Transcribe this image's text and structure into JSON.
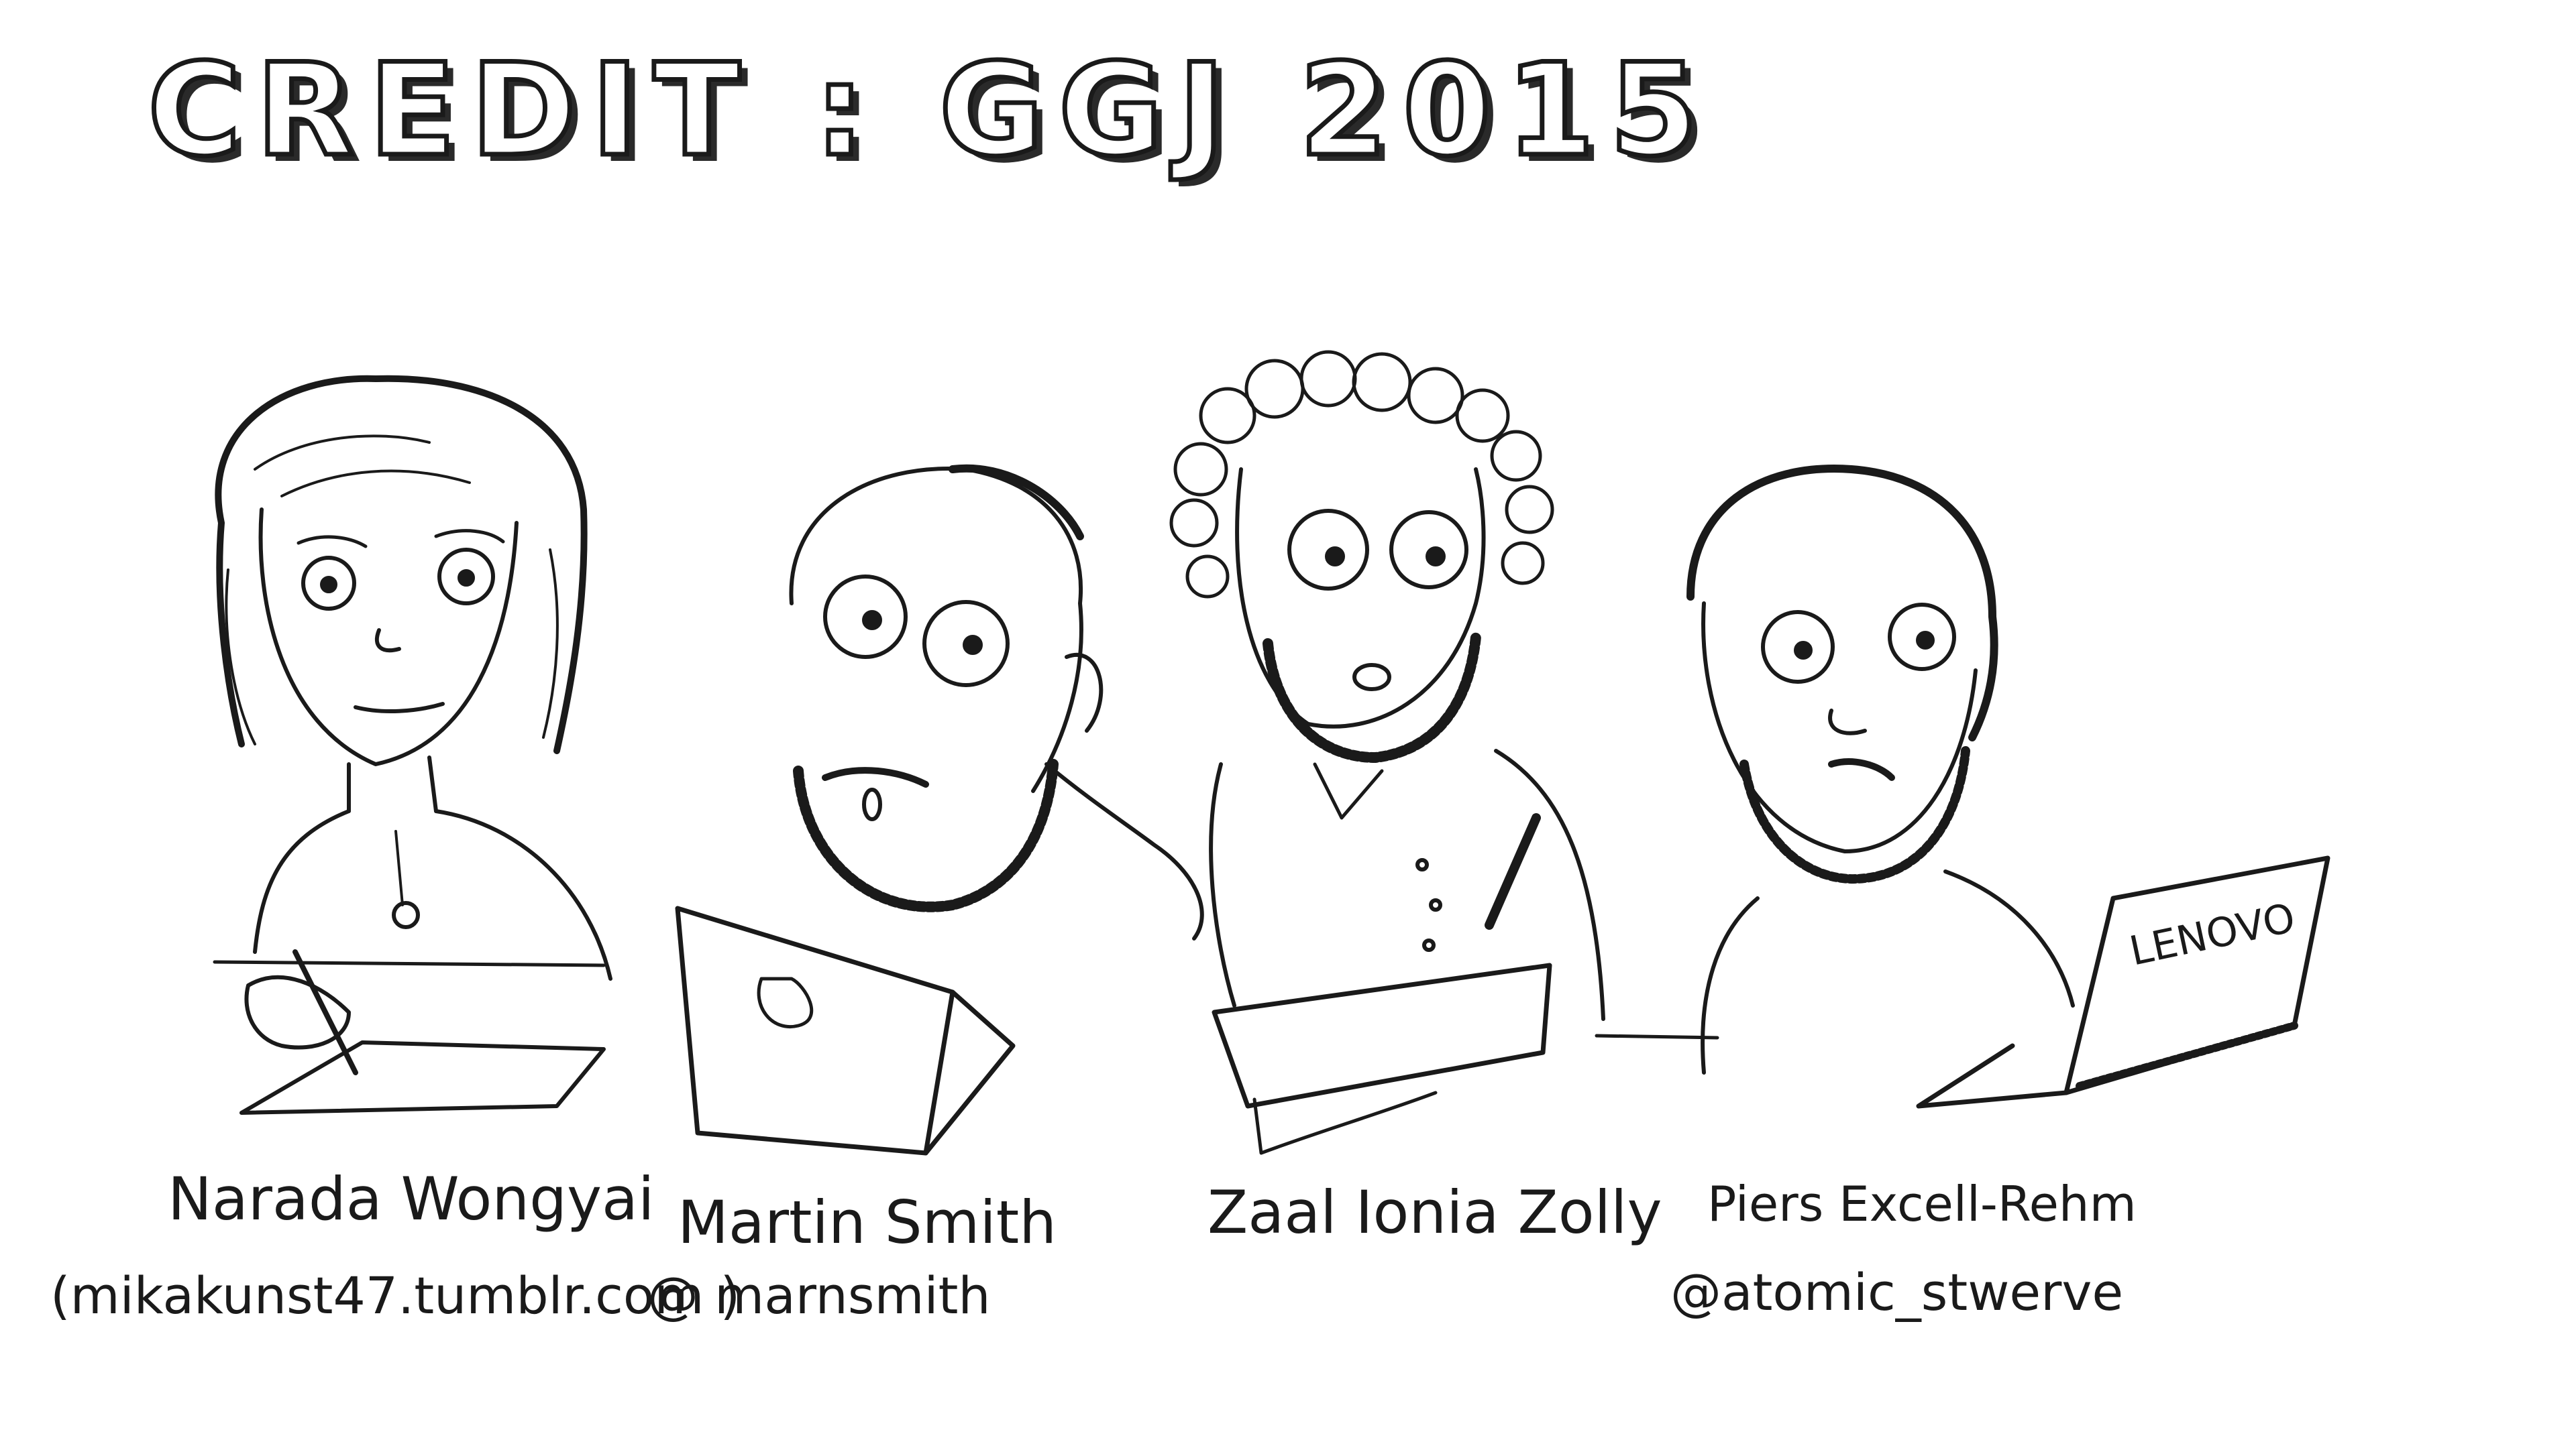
{
  "title": "CREDIT : GGJ 2015",
  "people": [
    {
      "name": "Narada Wongyai",
      "handle": "(mikakunst47.tumblr.com )"
    },
    {
      "name": "Martin Smith",
      "handle": "@ marnsmith"
    },
    {
      "name": "Zaal Ionia Zolly",
      "handle": ""
    },
    {
      "name": "Piers Excell-Rehm",
      "handle": "@atomic_stwerve"
    }
  ],
  "laptop_brand_text": "LENOVO",
  "colors": {
    "ink": "#1a1a1a",
    "paper": "#ffffff"
  }
}
